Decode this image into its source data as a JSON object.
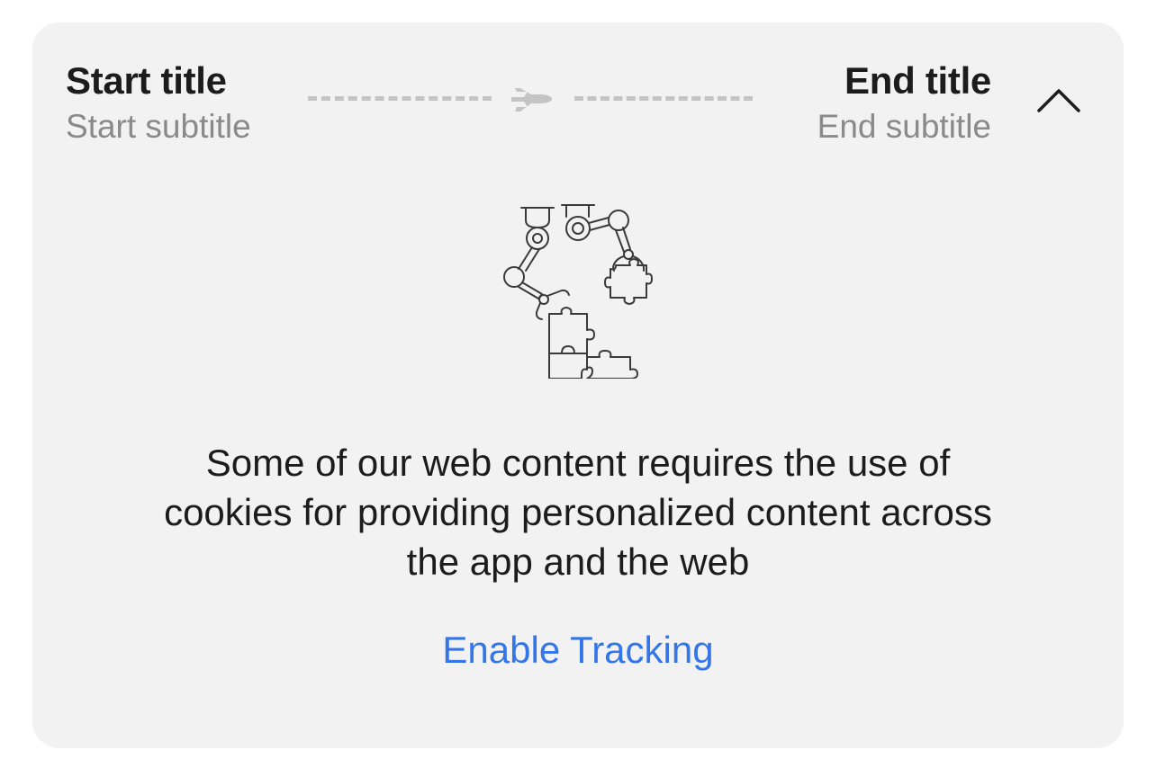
{
  "route": {
    "start": {
      "title": "Start title",
      "subtitle": "Start subtitle"
    },
    "end": {
      "title": "End title",
      "subtitle": "End subtitle"
    },
    "transport_icon": "airplane-icon",
    "toggle_icon": "chevron-up-icon"
  },
  "illustration": {
    "icon": "robot-arms-puzzle-illustration"
  },
  "message": {
    "text": "Some of our web content requires the use of cookies for providing personalized content across the app and the web"
  },
  "cta": {
    "label": "Enable Tracking"
  },
  "colors": {
    "card_background": "#f2f2f2",
    "title": "#1c1c1c",
    "subtitle": "#8a8a8a",
    "route_line": "#c4c4c4",
    "link": "#3476ea"
  }
}
